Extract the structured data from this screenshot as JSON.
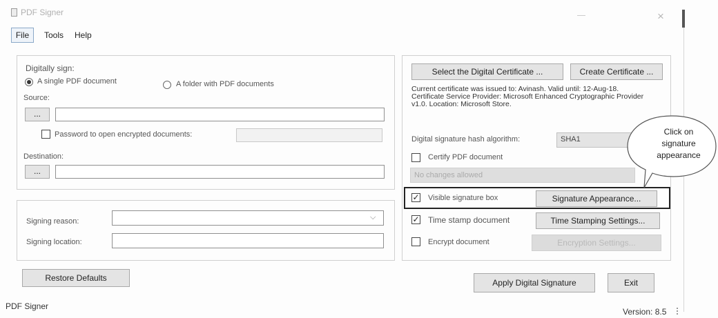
{
  "window": {
    "title": "PDF Signer",
    "close": "×"
  },
  "menu": {
    "items": [
      "File",
      "Tools",
      "Help"
    ]
  },
  "left": {
    "digitally_sign_label": "Digitally sign:",
    "radio_single": "A single PDF document",
    "radio_folder": "A folder with PDF documents",
    "source_label": "Source:",
    "browse": "...",
    "password_label": "Password to open encrypted documents:",
    "destination_label": "Destination:",
    "signing_reason_label": "Signing reason:",
    "signing_location_label": "Signing location:",
    "dropdown_arrow": "⌵"
  },
  "right": {
    "select_cert_button": "Select the Digital Certificate ...",
    "create_cert_button": "Create Certificate ...",
    "cert_info": "Current certificate was issued to: Avinash. Valid until: 12-Aug-18. Certificate Service Provider: Microsoft Enhanced Cryptographic Provider v1.0. Location: Microsoft Store.",
    "hash_label": "Digital signature hash algorithm:",
    "hash_value": "SHA1",
    "certify_label": "Certify PDF document",
    "certify_option": "No changes allowed",
    "visible_box_label": "Visible signature box",
    "signature_appearance_button": "Signature Appearance...",
    "timestamp_label": "Time stamp document",
    "timestamp_button": "Time Stamping Settings...",
    "encrypt_label": "Encrypt document",
    "encryption_button": "Encryption Settings...",
    "check_mark": "✓"
  },
  "callout": {
    "text": "Click on signature appearance"
  },
  "bottom": {
    "restore_button": "Restore Defaults",
    "apply_button": "Apply Digital Signature",
    "exit_button": "Exit"
  },
  "status": {
    "left": "PDF Signer",
    "version": "Version: 8.5"
  }
}
